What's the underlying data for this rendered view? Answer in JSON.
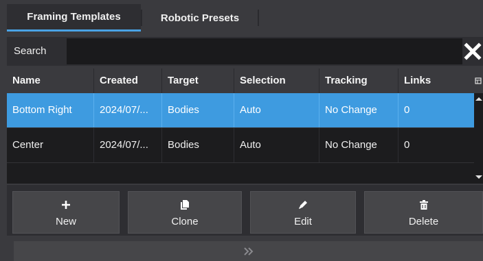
{
  "tabs": [
    {
      "label": "Framing Templates",
      "active": true
    },
    {
      "label": "Robotic Presets",
      "active": false
    }
  ],
  "search": {
    "label": "Search",
    "value": "",
    "placeholder": ""
  },
  "table": {
    "columns": [
      "Name",
      "Created",
      "Target",
      "Selection",
      "Tracking",
      "Links"
    ],
    "rows": [
      {
        "name": "Bottom Right",
        "created": "2024/07/...",
        "target": "Bodies",
        "selection": "Auto",
        "tracking": "No Change",
        "links": "0",
        "selected": true
      },
      {
        "name": "Center",
        "created": "2024/07/...",
        "target": "Bodies",
        "selection": "Auto",
        "tracking": "No Change",
        "links": "0",
        "selected": false
      }
    ]
  },
  "actions": {
    "new_label": "New",
    "clone_label": "Clone",
    "edit_label": "Edit",
    "delete_label": "Delete"
  },
  "icons": {
    "new": "plus-icon",
    "clone": "clone-icon",
    "edit": "pencil-icon",
    "delete": "trash-icon",
    "clear": "close-icon",
    "expand": "double-chevron-right-icon",
    "column_chooser": "column-chooser-icon"
  },
  "colors": {
    "accent": "#4aa3e6",
    "selected_row": "#3e9be0",
    "background": "#3a3a3e"
  }
}
